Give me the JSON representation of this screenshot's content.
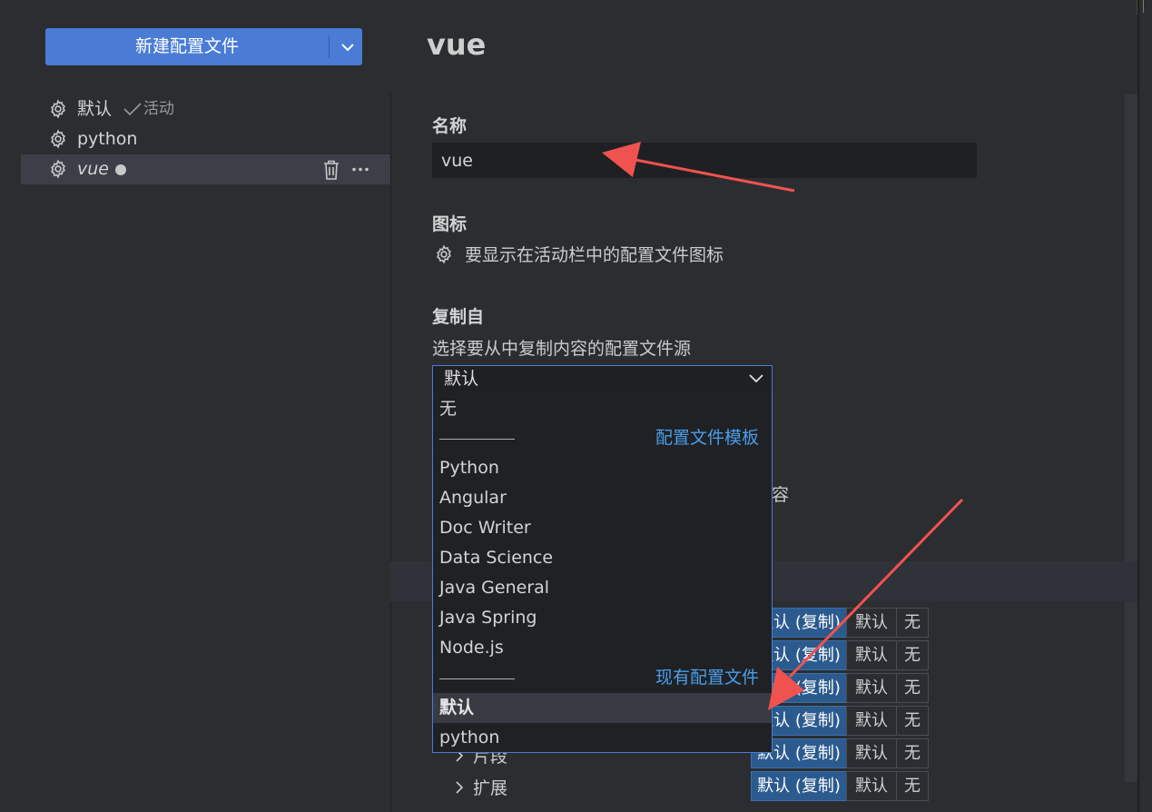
{
  "new_profile": {
    "label": "新建配置文件"
  },
  "sidebar": {
    "items": [
      {
        "name": "默认",
        "badge": "活动"
      },
      {
        "name": "python"
      },
      {
        "name": "vue"
      }
    ]
  },
  "main": {
    "title": "vue",
    "name_section": {
      "label": "名称",
      "value": "vue"
    },
    "icon_section": {
      "label": "图标",
      "description": "要显示在活动栏中的配置文件图标"
    },
    "copy_section": {
      "label": "复制自",
      "description": "选择要从中复制内容的配置文件源",
      "selected": "默认"
    },
    "partial_text": "容"
  },
  "dropdown": {
    "none_option": "无",
    "template_group": "配置文件模板",
    "templates": [
      "Python",
      "Angular",
      "Doc Writer",
      "Data Science",
      "Java General",
      "Java Spring",
      "Node.js"
    ],
    "existing_group": "现有配置文件",
    "existing": [
      "默认",
      "python"
    ]
  },
  "table": {
    "rows": [
      {
        "label": ""
      },
      {
        "label": ""
      },
      {
        "label": ""
      },
      {
        "label": ""
      },
      {
        "label": "片段"
      },
      {
        "label": "扩展"
      }
    ],
    "options": {
      "copy": "默认 (复制)",
      "default": "默认",
      "none": "无"
    }
  },
  "colors": {
    "accent": "#4a7cd6",
    "link": "#4a9ee8",
    "annotation_arrow": "#f0534f"
  },
  "icons": {
    "gear": "gear-icon",
    "trash": "trash-icon",
    "more": "ellipsis-icon",
    "check": "check-icon",
    "chevron": "chevron-down-icon"
  }
}
